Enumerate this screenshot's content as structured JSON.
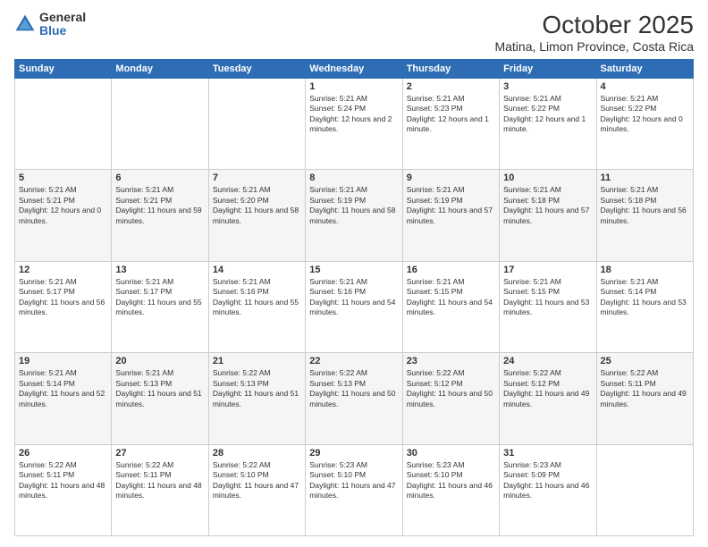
{
  "logo": {
    "general": "General",
    "blue": "Blue"
  },
  "header": {
    "month": "October 2025",
    "location": "Matina, Limon Province, Costa Rica"
  },
  "weekdays": [
    "Sunday",
    "Monday",
    "Tuesday",
    "Wednesday",
    "Thursday",
    "Friday",
    "Saturday"
  ],
  "weeks": [
    [
      {
        "day": "",
        "info": ""
      },
      {
        "day": "",
        "info": ""
      },
      {
        "day": "",
        "info": ""
      },
      {
        "day": "1",
        "info": "Sunrise: 5:21 AM\nSunset: 5:24 PM\nDaylight: 12 hours and 2 minutes."
      },
      {
        "day": "2",
        "info": "Sunrise: 5:21 AM\nSunset: 5:23 PM\nDaylight: 12 hours and 1 minute."
      },
      {
        "day": "3",
        "info": "Sunrise: 5:21 AM\nSunset: 5:22 PM\nDaylight: 12 hours and 1 minute."
      },
      {
        "day": "4",
        "info": "Sunrise: 5:21 AM\nSunset: 5:22 PM\nDaylight: 12 hours and 0 minutes."
      }
    ],
    [
      {
        "day": "5",
        "info": "Sunrise: 5:21 AM\nSunset: 5:21 PM\nDaylight: 12 hours and 0 minutes."
      },
      {
        "day": "6",
        "info": "Sunrise: 5:21 AM\nSunset: 5:21 PM\nDaylight: 11 hours and 59 minutes."
      },
      {
        "day": "7",
        "info": "Sunrise: 5:21 AM\nSunset: 5:20 PM\nDaylight: 11 hours and 58 minutes."
      },
      {
        "day": "8",
        "info": "Sunrise: 5:21 AM\nSunset: 5:19 PM\nDaylight: 11 hours and 58 minutes."
      },
      {
        "day": "9",
        "info": "Sunrise: 5:21 AM\nSunset: 5:19 PM\nDaylight: 11 hours and 57 minutes."
      },
      {
        "day": "10",
        "info": "Sunrise: 5:21 AM\nSunset: 5:18 PM\nDaylight: 11 hours and 57 minutes."
      },
      {
        "day": "11",
        "info": "Sunrise: 5:21 AM\nSunset: 5:18 PM\nDaylight: 11 hours and 56 minutes."
      }
    ],
    [
      {
        "day": "12",
        "info": "Sunrise: 5:21 AM\nSunset: 5:17 PM\nDaylight: 11 hours and 56 minutes."
      },
      {
        "day": "13",
        "info": "Sunrise: 5:21 AM\nSunset: 5:17 PM\nDaylight: 11 hours and 55 minutes."
      },
      {
        "day": "14",
        "info": "Sunrise: 5:21 AM\nSunset: 5:16 PM\nDaylight: 11 hours and 55 minutes."
      },
      {
        "day": "15",
        "info": "Sunrise: 5:21 AM\nSunset: 5:16 PM\nDaylight: 11 hours and 54 minutes."
      },
      {
        "day": "16",
        "info": "Sunrise: 5:21 AM\nSunset: 5:15 PM\nDaylight: 11 hours and 54 minutes."
      },
      {
        "day": "17",
        "info": "Sunrise: 5:21 AM\nSunset: 5:15 PM\nDaylight: 11 hours and 53 minutes."
      },
      {
        "day": "18",
        "info": "Sunrise: 5:21 AM\nSunset: 5:14 PM\nDaylight: 11 hours and 53 minutes."
      }
    ],
    [
      {
        "day": "19",
        "info": "Sunrise: 5:21 AM\nSunset: 5:14 PM\nDaylight: 11 hours and 52 minutes."
      },
      {
        "day": "20",
        "info": "Sunrise: 5:21 AM\nSunset: 5:13 PM\nDaylight: 11 hours and 51 minutes."
      },
      {
        "day": "21",
        "info": "Sunrise: 5:22 AM\nSunset: 5:13 PM\nDaylight: 11 hours and 51 minutes."
      },
      {
        "day": "22",
        "info": "Sunrise: 5:22 AM\nSunset: 5:13 PM\nDaylight: 11 hours and 50 minutes."
      },
      {
        "day": "23",
        "info": "Sunrise: 5:22 AM\nSunset: 5:12 PM\nDaylight: 11 hours and 50 minutes."
      },
      {
        "day": "24",
        "info": "Sunrise: 5:22 AM\nSunset: 5:12 PM\nDaylight: 11 hours and 49 minutes."
      },
      {
        "day": "25",
        "info": "Sunrise: 5:22 AM\nSunset: 5:11 PM\nDaylight: 11 hours and 49 minutes."
      }
    ],
    [
      {
        "day": "26",
        "info": "Sunrise: 5:22 AM\nSunset: 5:11 PM\nDaylight: 11 hours and 48 minutes."
      },
      {
        "day": "27",
        "info": "Sunrise: 5:22 AM\nSunset: 5:11 PM\nDaylight: 11 hours and 48 minutes."
      },
      {
        "day": "28",
        "info": "Sunrise: 5:22 AM\nSunset: 5:10 PM\nDaylight: 11 hours and 47 minutes."
      },
      {
        "day": "29",
        "info": "Sunrise: 5:23 AM\nSunset: 5:10 PM\nDaylight: 11 hours and 47 minutes."
      },
      {
        "day": "30",
        "info": "Sunrise: 5:23 AM\nSunset: 5:10 PM\nDaylight: 11 hours and 46 minutes."
      },
      {
        "day": "31",
        "info": "Sunrise: 5:23 AM\nSunset: 5:09 PM\nDaylight: 11 hours and 46 minutes."
      },
      {
        "day": "",
        "info": ""
      }
    ]
  ]
}
